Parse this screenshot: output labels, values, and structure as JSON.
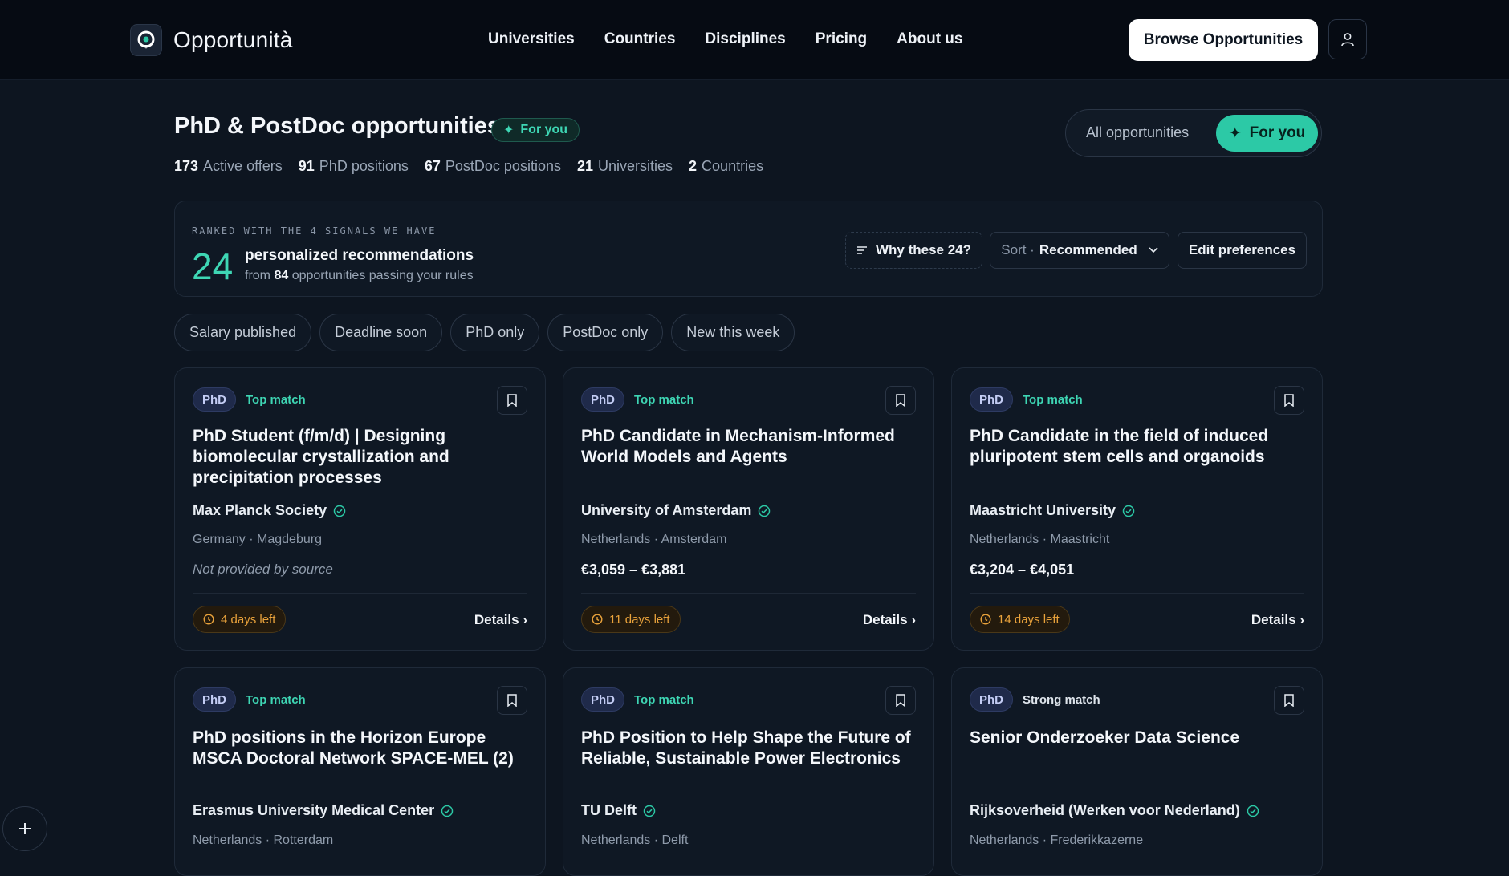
{
  "brand": {
    "name": "Opportunità"
  },
  "nav": {
    "links": [
      "Universities",
      "Countries",
      "Disciplines",
      "Pricing",
      "About us"
    ],
    "browse_label": "Browse Opportunities"
  },
  "header": {
    "title": "PhD & PostDoc opportunities",
    "badge": "For you",
    "stats": [
      {
        "value": "173",
        "label": "Active offers"
      },
      {
        "value": "91",
        "label": "PhD positions"
      },
      {
        "value": "67",
        "label": "PostDoc positions"
      },
      {
        "value": "21",
        "label": "Universities"
      },
      {
        "value": "2",
        "label": "Countries"
      }
    ],
    "toggle": {
      "all": "All opportunities",
      "foryou": "For you"
    }
  },
  "recs": {
    "kicker": "RANKED WITH THE 4 SIGNALS WE HAVE",
    "count": "24",
    "title": "personalized recommendations",
    "sub_prefix": "from",
    "sub_count": "84",
    "sub_suffix": "opportunities passing your rules",
    "why_label": "Why these 24?",
    "sort_prefix": "Sort ·",
    "sort_value": "Recommended",
    "edit_label": "Edit preferences"
  },
  "chips": [
    "Salary published",
    "Deadline soon",
    "PhD only",
    "PostDoc only",
    "New this week"
  ],
  "cards": [
    {
      "type": "PhD",
      "match": "Top match",
      "title": "PhD Student (f/m/d) | Designing biomolecular crystallization and precipitation processes",
      "org": "Max Planck Society",
      "location": "Germany · Magdeburg",
      "salary": "Not provided by source",
      "deadline": "4 days left",
      "details": "Details ›"
    },
    {
      "type": "PhD",
      "match": "Top match",
      "title": "PhD Candidate in Mechanism-Informed World Models and Agents",
      "org": "University of Amsterdam",
      "location": "Netherlands · Amsterdam",
      "salary": "€3,059 – €3,881",
      "deadline": "11 days left",
      "details": "Details ›"
    },
    {
      "type": "PhD",
      "match": "Top match",
      "title": "PhD Candidate in the field of induced pluripotent stem cells and organoids",
      "org": "Maastricht University",
      "location": "Netherlands · Maastricht",
      "salary": "€3,204 – €4,051",
      "deadline": "14 days left",
      "details": "Details ›"
    },
    {
      "type": "PhD",
      "match": "Top match",
      "title": "PhD positions in the Horizon Europe MSCA Doctoral Network SPACE-MEL (2)",
      "org": "Erasmus University Medical Center",
      "location": "Netherlands · Rotterdam"
    },
    {
      "type": "PhD",
      "match": "Top match",
      "title": "PhD Position to Help Shape the Future of Reliable, Sustainable Power Electronics",
      "org": "TU Delft",
      "location": "Netherlands · Delft"
    },
    {
      "type": "PhD",
      "match": "Strong match",
      "title": "Senior Onderzoeker Data Science",
      "org": "Rijksoverheid (Werken voor Nederland)",
      "location": "Netherlands · Frederikkazerne"
    }
  ],
  "colors": {
    "accent": "#2cc9a6",
    "warning": "#e9a23b",
    "background": "#0d1520"
  }
}
